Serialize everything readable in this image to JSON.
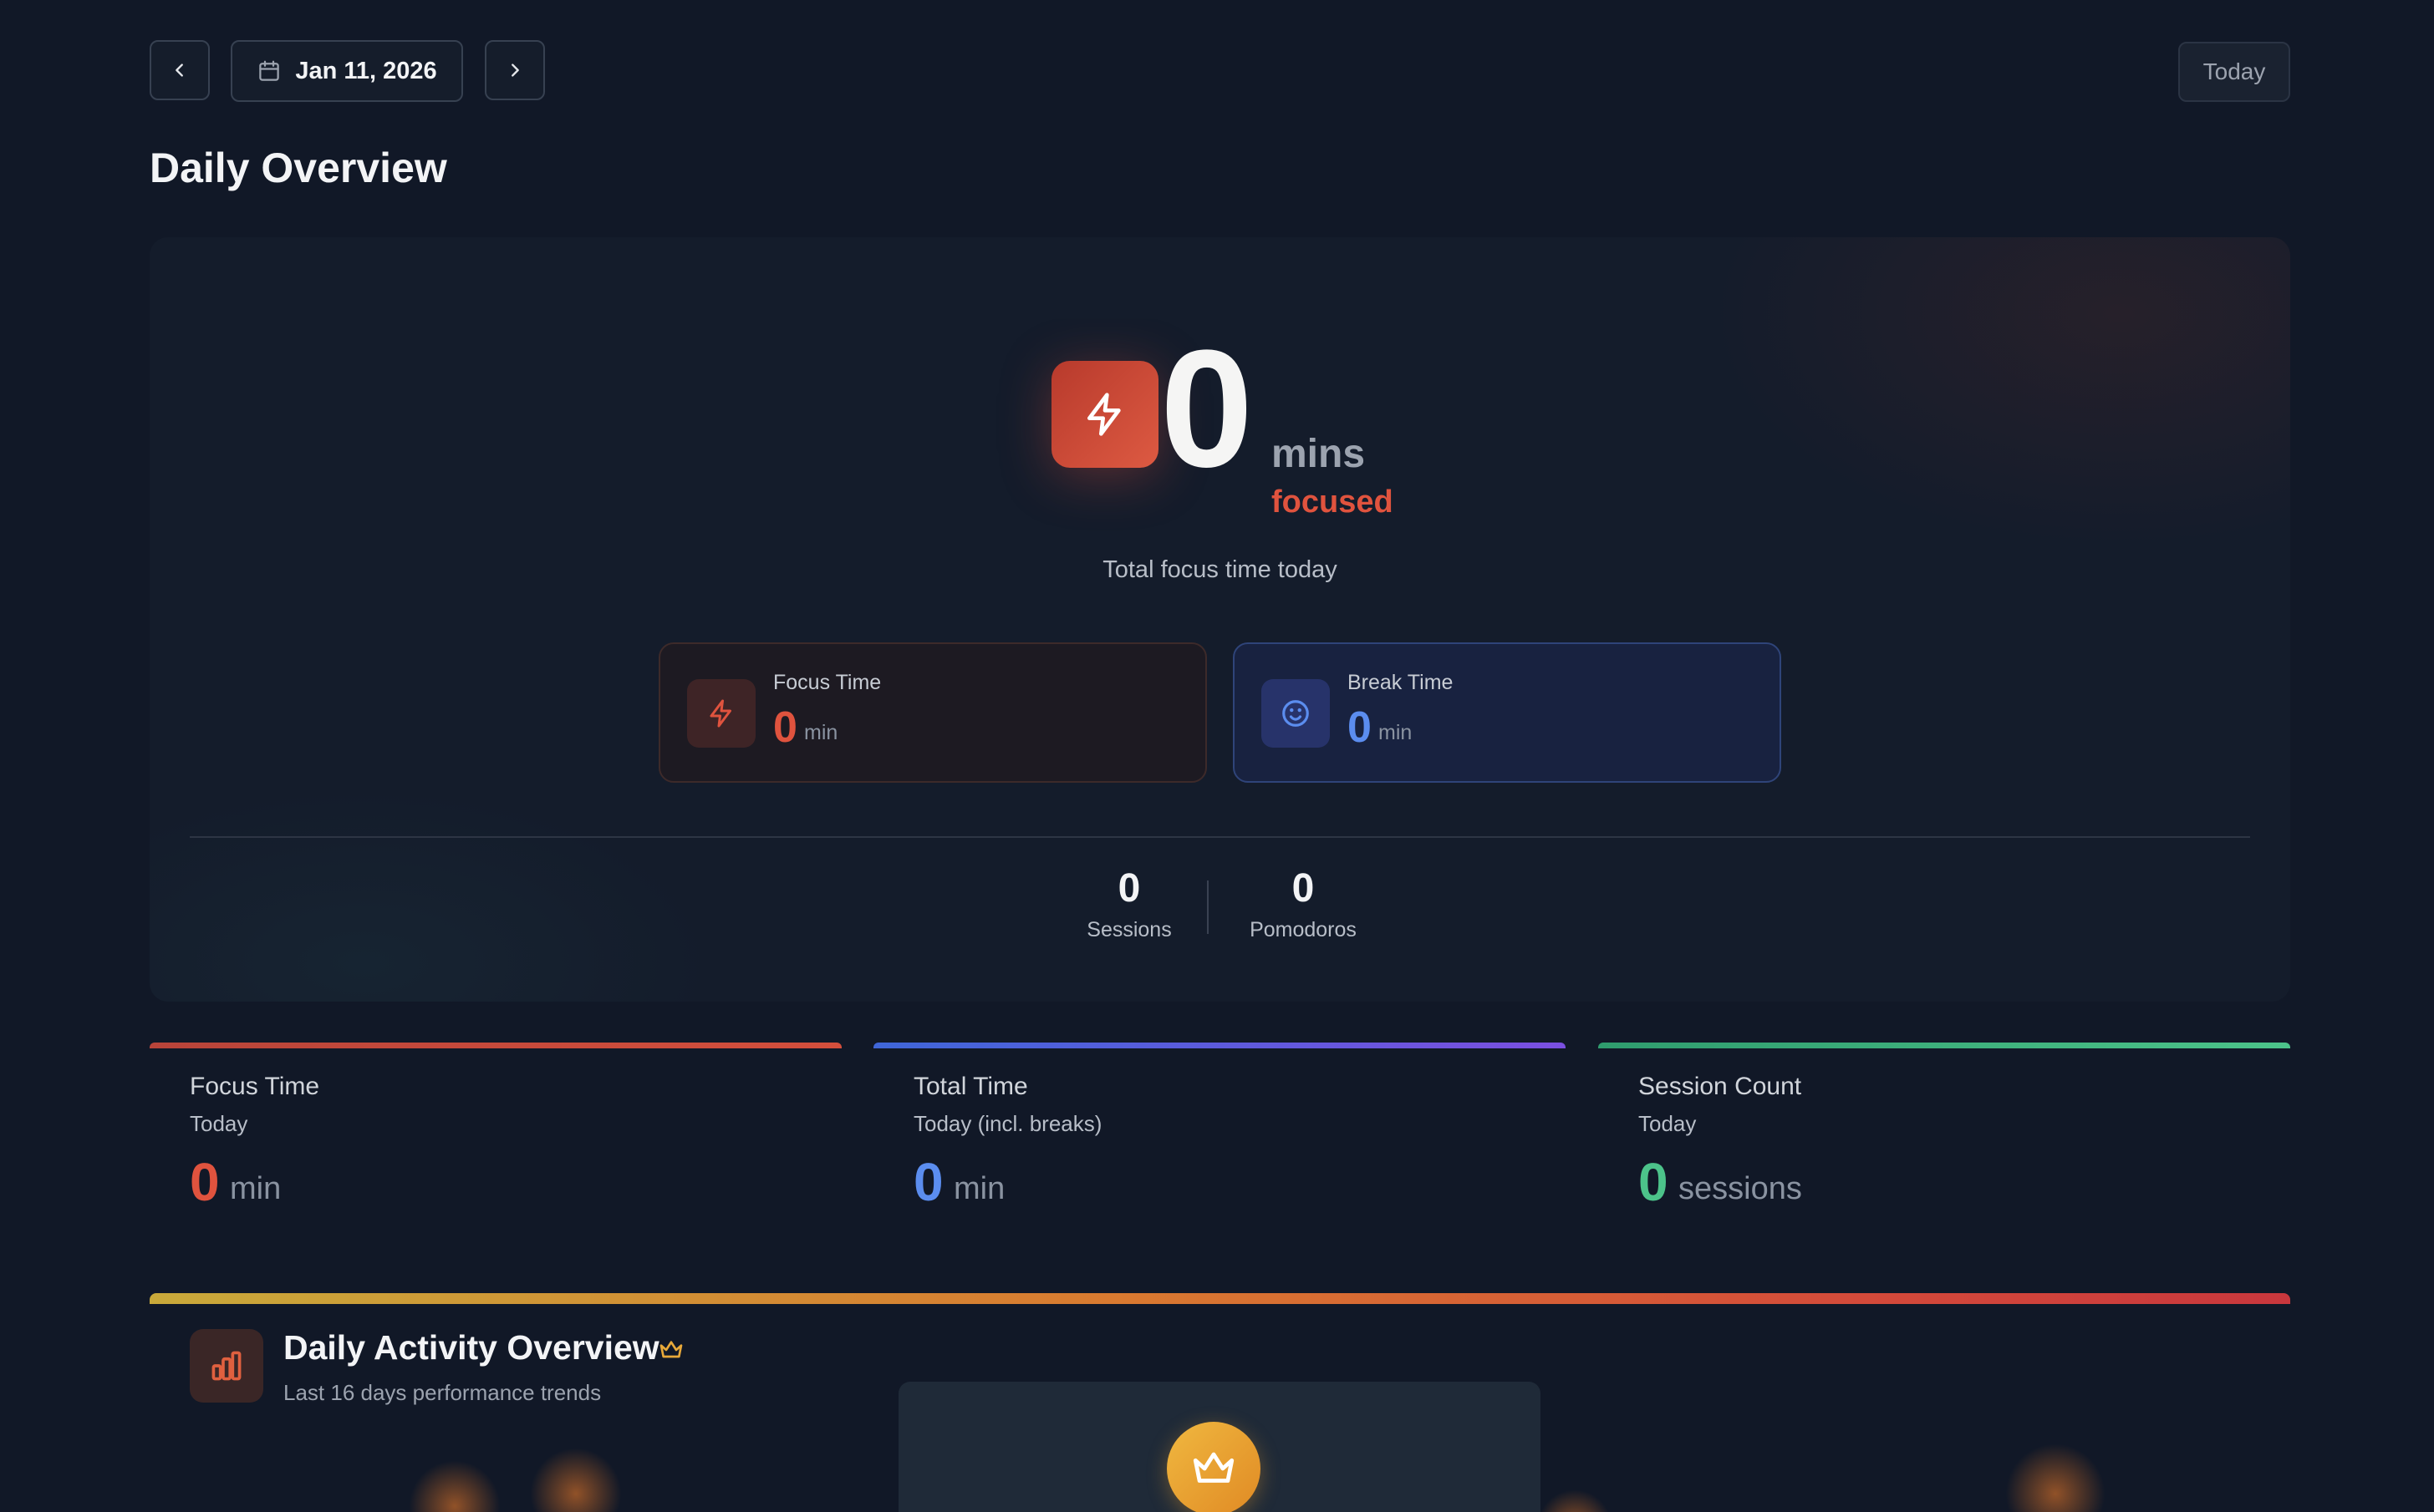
{
  "header": {
    "prev_label": "Previous day",
    "date": "Jan 11, 2026",
    "next_label": "Next day",
    "today_label": "Today",
    "title": "Daily Overview"
  },
  "hero": {
    "total_value": "0",
    "total_unit": "mins",
    "total_label": "focused",
    "subtitle": "Total focus time today",
    "focus": {
      "label": "Focus Time",
      "value": "0",
      "unit": "min"
    },
    "break": {
      "label": "Break Time",
      "value": "0",
      "unit": "min"
    },
    "sessions": {
      "value": "0",
      "label": "Sessions"
    },
    "pomodoros": {
      "value": "0",
      "label": "Pomodoros"
    }
  },
  "stats": [
    {
      "title": "Focus Time",
      "subtitle": "Today",
      "value": "0",
      "unit": "min",
      "color": "#e0533e"
    },
    {
      "title": "Total Time",
      "subtitle": "Today (incl. breaks)",
      "value": "0",
      "unit": "min",
      "color": "#5b8def"
    },
    {
      "title": "Session Count",
      "subtitle": "Today",
      "value": "0",
      "unit": "sessions",
      "color": "#4cc38a"
    }
  ],
  "activity": {
    "title": "Daily Activity Overview",
    "subtitle": "Last 16 days performance trends"
  },
  "colors": {
    "background": "#111827",
    "accent_red": "#e0533e",
    "accent_blue": "#5b8def",
    "accent_green": "#4cc38a",
    "gold": "#f0b840"
  },
  "icons": {
    "prev": "chevron-left-icon",
    "date": "calendar-icon",
    "next": "chevron-right-icon",
    "focus": "lightning-icon",
    "break": "smile-icon",
    "activity": "bar-chart-icon",
    "premium": "crown-icon"
  }
}
